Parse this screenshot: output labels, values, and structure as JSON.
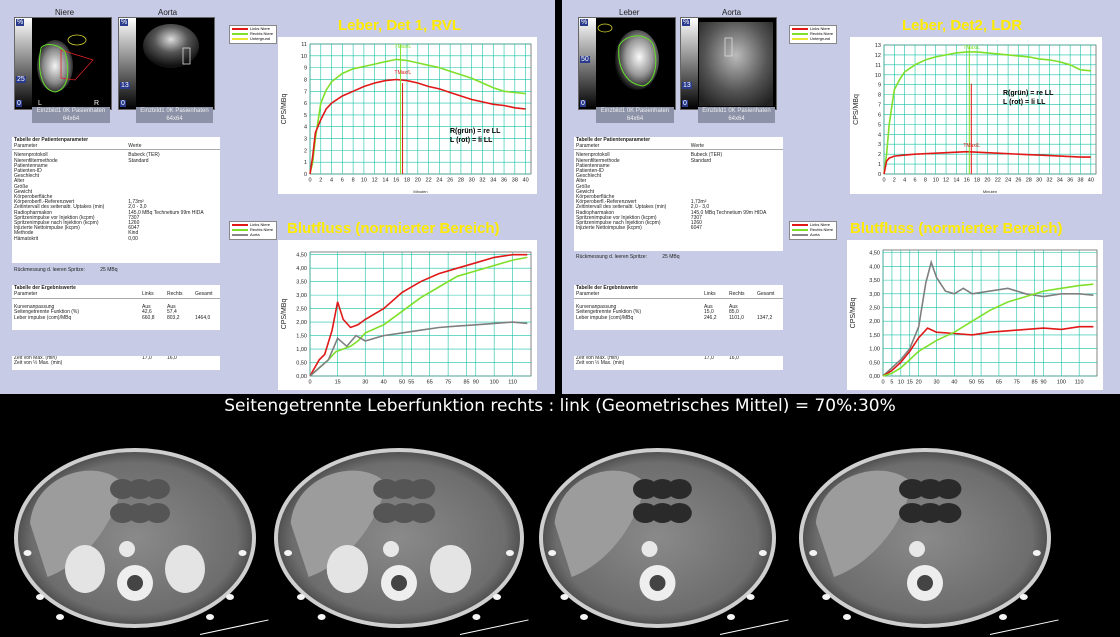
{
  "caption": "Seitengetrennte Leberfunktion rechts : link (Geometrisches Mittel) = 70%:30%",
  "colors": {
    "panel_bg": "#c7cbe5",
    "title": "#ffeb00",
    "green": "#7ee02a",
    "red": "#e01818",
    "gray": "#7f7f7f",
    "grid": "#19c2a6"
  },
  "left": {
    "img1_label": "Niere",
    "img2_label": "Aorta",
    "img_caption": "Einzbild1 0K Pasienhaten",
    "img_size": "64x64",
    "scale_pct": "%",
    "scale_val": "25",
    "scale_zero": "0",
    "img2_scale_val": "13",
    "marker_l": "L",
    "marker_r": "R",
    "legend_top": [
      "Links Niere",
      "Rechts Niere",
      "Untergrund"
    ],
    "legend_bottom": [
      "Links Niere",
      "Rechts Niere",
      "Aorta"
    ],
    "chart1": {
      "title": "Leber, Det 1, RVL",
      "ylabel": "CPS/MBq",
      "xlabel": "Minuten",
      "ylim": [
        0,
        11
      ],
      "yticks": [
        0,
        1,
        2,
        3,
        4,
        5,
        6,
        7,
        8,
        9,
        10,
        11
      ],
      "xlim": [
        0,
        41
      ],
      "xticks": [
        0,
        2,
        4,
        6,
        8,
        10,
        12,
        14,
        16,
        18,
        20,
        22,
        24,
        26,
        28,
        30,
        32,
        34,
        36,
        38,
        40
      ],
      "annot_green": "TMax/L",
      "annot_red": "TMax/L",
      "note1": "R(grün) = re LL",
      "note2": "L  (rot)   = li LL",
      "marker_x": 16.8,
      "series": [
        {
          "color": "green",
          "x": [
            0,
            0.5,
            1,
            2,
            3,
            4,
            6,
            8,
            10,
            12,
            14,
            16,
            18,
            20,
            22,
            24,
            26,
            28,
            30,
            32,
            34,
            36,
            38,
            40
          ],
          "y": [
            0,
            1,
            3,
            6,
            7.1,
            7.8,
            8.5,
            8.9,
            9.1,
            9.3,
            9.5,
            9.7,
            9.6,
            9.4,
            9.2,
            9.0,
            8.7,
            8.4,
            8.1,
            7.7,
            7.3,
            7.0,
            6.9,
            6.8
          ]
        },
        {
          "color": "red",
          "x": [
            0,
            0.5,
            1,
            2,
            3,
            4,
            6,
            8,
            10,
            12,
            14,
            16,
            18,
            20,
            22,
            24,
            26,
            28,
            30,
            32,
            34,
            36,
            38,
            40
          ],
          "y": [
            0,
            1.5,
            3.5,
            4.6,
            5.5,
            6.0,
            6.6,
            7.0,
            7.4,
            7.7,
            7.9,
            8.0,
            7.9,
            7.7,
            7.4,
            7.2,
            6.9,
            6.6,
            6.3,
            6.1,
            5.9,
            5.8,
            5.6,
            5.5
          ]
        }
      ]
    },
    "chart2": {
      "title": "Blutfluss (normierter Bereich)",
      "ylabel": "CPS/MBq",
      "ylim": [
        0,
        4.6
      ],
      "yticks": [
        0,
        0.5,
        1,
        1.5,
        2,
        2.5,
        3,
        3.5,
        4,
        4.5
      ],
      "ytick_labels": [
        "0,00",
        "0,50",
        "1,00",
        "1,50",
        "2,00",
        "2,50",
        "3,00",
        "3,50",
        "4,00",
        "4,50"
      ],
      "xlim": [
        0,
        120
      ],
      "xticks": [
        0,
        15,
        30,
        40,
        50,
        55,
        65,
        75,
        85,
        90,
        100,
        110
      ],
      "series": [
        {
          "color": "green",
          "x": [
            0,
            5,
            10,
            14,
            18,
            22,
            26,
            30,
            40,
            50,
            60,
            70,
            80,
            90,
            100,
            110,
            118
          ],
          "y": [
            0,
            0.3,
            0.6,
            0.9,
            1.0,
            1.1,
            1.3,
            1.6,
            1.9,
            2.4,
            2.9,
            3.3,
            3.7,
            3.9,
            4.1,
            4.3,
            4.4
          ]
        },
        {
          "color": "red",
          "x": [
            0,
            5,
            8,
            12,
            15,
            18,
            22,
            26,
            30,
            40,
            50,
            60,
            70,
            80,
            90,
            100,
            110,
            118
          ],
          "y": [
            0,
            0.6,
            0.8,
            1.7,
            2.75,
            2.1,
            1.8,
            1.9,
            2.1,
            2.5,
            3.1,
            3.5,
            3.8,
            4.0,
            4.2,
            4.4,
            4.5,
            4.5
          ]
        },
        {
          "color": "gray",
          "x": [
            0,
            5,
            10,
            15,
            20,
            25,
            30,
            40,
            50,
            60,
            70,
            80,
            90,
            100,
            110,
            118
          ],
          "y": [
            0,
            0.3,
            0.6,
            1.4,
            1.1,
            1.5,
            1.3,
            1.5,
            1.6,
            1.7,
            1.8,
            1.85,
            1.9,
            1.95,
            2.0,
            1.95
          ]
        }
      ]
    },
    "table_title": "Tabelle der Patientenparameter",
    "table_head": [
      "Parameter",
      "Werte"
    ],
    "table_rows": [
      [
        "Nierenprotokoll",
        "Bubeck (TER)"
      ],
      [
        "Nierenfiltermethode",
        "Standard"
      ],
      [
        "Patientenname",
        ""
      ],
      [
        "Patienten-ID",
        ""
      ],
      [
        "Geschlecht",
        ""
      ],
      [
        "Alter",
        ""
      ],
      [
        "Größe",
        ""
      ],
      [
        "Gewicht",
        ""
      ],
      [
        "Körperoberfläche",
        ""
      ],
      [
        "Körperoberfl.-Referenzwert",
        "1,73m²"
      ],
      [
        "Zeitintervall des seitenaltr. Uptakes (min)",
        "2,0 - 3,0"
      ],
      [
        "Radiopharmakon",
        "145,0 MBq Technetium 99m HIDA"
      ],
      [
        "Spritzenimpulse vor Injektion (kcpm)",
        "7307"
      ],
      [
        "Spritzenimpulse nach Injektion (kcpm)",
        "1260"
      ],
      [
        "Injizierte Nettoimpulse (kcpm)",
        "6047"
      ],
      [
        "Methode",
        "Kind"
      ],
      [
        "Hämatokrit",
        "0,00"
      ]
    ],
    "spritze_label": "Rückmessung d. leeren Spritze:",
    "spritze_value": "25 MBq",
    "results_title": "Tabelle der Ergebniswerte",
    "results_head": [
      "Parameter",
      "Links",
      "Rechts",
      "Gesamt"
    ],
    "results_rows": [
      [
        "Kurvenanpassung",
        "Aus",
        "Aus",
        ""
      ],
      [
        "Seitengetrennte Funktion (%)",
        "42,6",
        "57,4",
        ""
      ],
      [
        "Leber impulse (com)/MBq",
        "660,8",
        "803,2",
        "1464,0"
      ]
    ],
    "time_rows": [
      [
        "Zeit von Max. (min)",
        "17,0",
        "16,0"
      ],
      [
        "Zeit von ½ Max. (min)",
        "",
        ""
      ]
    ]
  },
  "right": {
    "img1_label": "Leber",
    "img2_label": "Aorta",
    "img_caption": "Einzbild1 0K Pasienhaten",
    "img_size": "64x64",
    "scale_pct": "%",
    "scale_val": "50",
    "scale_zero": "0",
    "img2_scale_val": "13",
    "legend_top": [
      "Links Niere",
      "Rechts Niere",
      "Untergrund"
    ],
    "legend_bottom": [
      "Links Niere",
      "Rechts Niere",
      "Aorta"
    ],
    "chart1": {
      "title": "Leber, Det2, LDR",
      "ylabel": "CPS/MBq",
      "xlabel": "Minuten",
      "ylim": [
        0,
        13
      ],
      "yticks": [
        0,
        1,
        2,
        3,
        4,
        5,
        6,
        7,
        8,
        9,
        10,
        11,
        12,
        13
      ],
      "xlim": [
        0,
        41
      ],
      "xticks": [
        0,
        2,
        4,
        6,
        8,
        10,
        12,
        14,
        16,
        18,
        20,
        22,
        24,
        26,
        28,
        30,
        32,
        34,
        36,
        38,
        40
      ],
      "annot_green": "TMax/L",
      "annot_red": "TMax/L",
      "note1": "R(grün) = re LL",
      "note2": "L  (rot)   = li LL",
      "marker_x": 16.5,
      "series": [
        {
          "color": "green",
          "x": [
            0,
            0.5,
            1,
            2,
            3,
            4,
            6,
            8,
            10,
            12,
            14,
            16,
            18,
            20,
            22,
            24,
            26,
            28,
            30,
            32,
            34,
            36,
            38,
            40
          ],
          "y": [
            0,
            2,
            5,
            8.5,
            9.5,
            10.3,
            11,
            11.5,
            11.8,
            12,
            12.2,
            12.3,
            12.3,
            12.2,
            12.1,
            12,
            11.9,
            11.8,
            11.6,
            11.5,
            11.3,
            11.0,
            10.5,
            10.4
          ]
        },
        {
          "color": "red",
          "x": [
            0,
            0.5,
            1,
            2,
            4,
            6,
            8,
            10,
            12,
            14,
            16,
            18,
            20,
            22,
            24,
            26,
            28,
            30,
            32,
            34,
            36,
            38,
            40
          ],
          "y": [
            0,
            1.3,
            1.6,
            1.8,
            1.9,
            2.0,
            2.05,
            2.1,
            2.15,
            2.2,
            2.25,
            2.2,
            2.15,
            2.1,
            2.05,
            2.0,
            1.95,
            1.9,
            1.85,
            1.8,
            1.75,
            1.7,
            1.7
          ]
        }
      ]
    },
    "chart2": {
      "title": "Blutfluss (normierter Bereich)",
      "ylabel": "CPS/MBq",
      "ylim": [
        0,
        4.6
      ],
      "yticks": [
        0,
        0.5,
        1,
        1.5,
        2,
        2.5,
        3,
        3.5,
        4,
        4.5
      ],
      "ytick_labels": [
        "0,00",
        "0,50",
        "1,00",
        "1,50",
        "2,00",
        "2,50",
        "3,00",
        "3,50",
        "4,00",
        "4,50"
      ],
      "xlim": [
        0,
        120
      ],
      "xticks": [
        0,
        5,
        10,
        15,
        20,
        30,
        40,
        50,
        55,
        65,
        75,
        85,
        90,
        100,
        110
      ],
      "series": [
        {
          "color": "gray",
          "x": [
            0,
            5,
            10,
            15,
            20,
            24,
            27,
            30,
            35,
            40,
            45,
            50,
            60,
            70,
            80,
            90,
            100,
            110,
            118
          ],
          "y": [
            0,
            0.3,
            0.6,
            1.0,
            1.8,
            3.4,
            4.15,
            3.6,
            3.1,
            3.0,
            3.2,
            3.0,
            3.1,
            3.2,
            3.0,
            2.9,
            3.0,
            3.0,
            2.95
          ]
        },
        {
          "color": "red",
          "x": [
            0,
            5,
            10,
            15,
            20,
            25,
            30,
            40,
            50,
            60,
            70,
            80,
            90,
            100,
            110,
            118
          ],
          "y": [
            0,
            0.2,
            0.5,
            0.9,
            1.4,
            1.75,
            1.6,
            1.55,
            1.5,
            1.6,
            1.65,
            1.7,
            1.75,
            1.7,
            1.8,
            1.8
          ]
        },
        {
          "color": "green",
          "x": [
            0,
            5,
            10,
            15,
            20,
            25,
            30,
            40,
            50,
            60,
            70,
            80,
            90,
            100,
            110,
            118
          ],
          "y": [
            0,
            0.1,
            0.3,
            0.6,
            0.9,
            1.1,
            1.3,
            1.6,
            2.0,
            2.4,
            2.7,
            2.9,
            3.1,
            3.2,
            3.3,
            3.35
          ]
        }
      ]
    },
    "table_title": "Tabelle der Patientenparameter",
    "table_head": [
      "Parameter",
      "Werte"
    ],
    "table_rows": [
      [
        "Nierenprotokoll",
        "Bubeck (TER)"
      ],
      [
        "Nierenfiltermethode",
        "Standard"
      ],
      [
        "Patientenname",
        ""
      ],
      [
        "Patienten-ID",
        ""
      ],
      [
        "Geschlecht",
        ""
      ],
      [
        "Alter",
        ""
      ],
      [
        "Größe",
        ""
      ],
      [
        "Gewicht",
        ""
      ],
      [
        "Körperoberfläche",
        ""
      ],
      [
        "Körperoberfl.-Referenzwert",
        "1,73m²"
      ],
      [
        "Zeitintervall des seitenaltr. Uptakes (min)",
        "2,0 - 3,0"
      ],
      [
        "Radiopharmakon",
        "145,0 MBq Technetium 99m HIDA"
      ],
      [
        "Spritzenimpulse vor Injektion (kcpm)",
        "7307"
      ],
      [
        "Spritzenimpulse nach Injektion (kcpm)",
        "1260"
      ],
      [
        "Injizierte Nettoimpulse (kcpm)",
        "6047"
      ]
    ],
    "spritze_label": "Rückmessung d. leeren Spritze:",
    "spritze_value": "25 MBq",
    "results_title": "Tabelle der Ergebniswerte",
    "results_head": [
      "Parameter",
      "Links",
      "Rechts",
      "Gesamt"
    ],
    "results_rows": [
      [
        "Kurvenanpassung",
        "Aus",
        "Aus",
        ""
      ],
      [
        "Seitengetrennte Funktion (%)",
        "15,0",
        "85,0",
        ""
      ],
      [
        "Leber impulse (com)/MBq",
        "246,2",
        "1101,0",
        "1347,2"
      ]
    ],
    "time_rows": [
      [
        "Zeit von Max. (min)",
        "17,0",
        "16,0"
      ],
      [
        "Zeit von ½ Max. (min)",
        "",
        ""
      ]
    ]
  },
  "chart_data": [
    {
      "type": "line",
      "title": "Leber, Det 1, RVL",
      "ylabel": "CPS/MBq",
      "xlabel": "Minuten",
      "ylim": [
        0,
        11
      ],
      "xlim": [
        0,
        41
      ]
    },
    {
      "type": "line",
      "title": "Blutfluss (normierter Bereich)",
      "ylabel": "CPS/MBq",
      "ylim": [
        0,
        4.6
      ],
      "xlim": [
        0,
        120
      ]
    },
    {
      "type": "line",
      "title": "Leber, Det2, LDR",
      "ylabel": "CPS/MBq",
      "xlabel": "Minuten",
      "ylim": [
        0,
        13
      ],
      "xlim": [
        0,
        41
      ]
    },
    {
      "type": "line",
      "title": "Blutfluss (normierter Bereich)",
      "ylabel": "CPS/MBq",
      "ylim": [
        0,
        4.6
      ],
      "xlim": [
        0,
        120
      ]
    }
  ]
}
